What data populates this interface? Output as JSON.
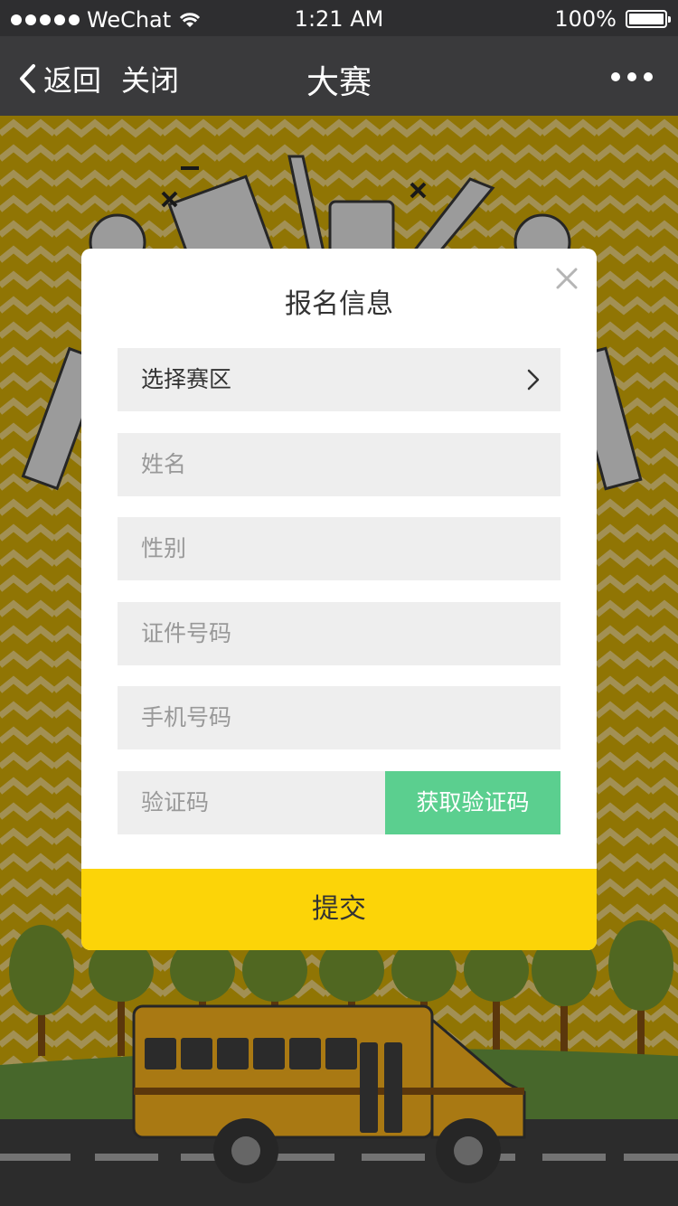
{
  "status_bar": {
    "carrier": "WeChat",
    "time": "1:21 AM",
    "battery": "100%"
  },
  "nav": {
    "back_label": "返回",
    "close_label": "关闭",
    "title": "大赛"
  },
  "modal": {
    "title": "报名信息",
    "fields": {
      "region": "选择赛区",
      "name_placeholder": "姓名",
      "gender_placeholder": "性别",
      "id_placeholder": "证件号码",
      "phone_placeholder": "手机号码",
      "code_placeholder": "验证码"
    },
    "get_code_label": "获取验证码",
    "submit_label": "提交"
  },
  "colors": {
    "nav_bg": "#3a3a3c",
    "background": "#b8960a",
    "accent_green": "#5bcf8f",
    "submit_yellow": "#fcd408"
  }
}
